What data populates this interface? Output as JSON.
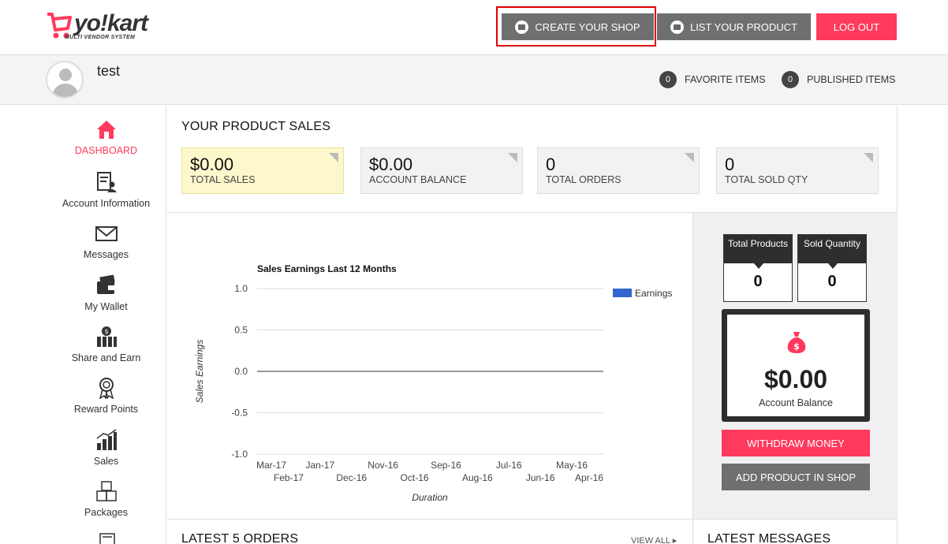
{
  "header": {
    "logo_text": "yo!kart",
    "logo_tagline": "MULTI VENDOR SYSTEM",
    "create_shop_label": "CREATE YOUR SHOP",
    "list_product_label": "LIST YOUR PRODUCT",
    "logout_label": "LOG OUT"
  },
  "profile": {
    "username": "test",
    "favorite_count": "0",
    "favorite_label": "FAVORITE ITEMS",
    "published_count": "0",
    "published_label": "PUBLISHED ITEMS"
  },
  "sidebar": {
    "items": [
      {
        "label": "DASHBOARD",
        "icon": "home-icon",
        "active": true
      },
      {
        "label": "Account Information",
        "icon": "account-info-icon"
      },
      {
        "label": "Messages",
        "icon": "envelope-icon"
      },
      {
        "label": "My Wallet",
        "icon": "wallet-icon"
      },
      {
        "label": "Share and Earn",
        "icon": "share-earn-icon"
      },
      {
        "label": "Reward Points",
        "icon": "award-icon"
      },
      {
        "label": "Sales",
        "icon": "sales-chart-icon"
      },
      {
        "label": "Packages",
        "icon": "packages-icon"
      }
    ]
  },
  "sales": {
    "title": "YOUR PRODUCT SALES",
    "cards": [
      {
        "value": "$0.00",
        "label": "TOTAL SALES"
      },
      {
        "value": "$0.00",
        "label": "ACCOUNT BALANCE"
      },
      {
        "value": "0",
        "label": "TOTAL ORDERS"
      },
      {
        "value": "0",
        "label": "TOTAL SOLD QTY"
      }
    ]
  },
  "chart_data": {
    "type": "line",
    "title": "Sales Earnings Last 12 Months",
    "xlabel": "Duration",
    "ylabel": "Sales Earnings",
    "categories": [
      "Mar-17",
      "Feb-17",
      "Jan-17",
      "Dec-16",
      "Nov-16",
      "Oct-16",
      "Sep-16",
      "Aug-16",
      "Jul-16",
      "Jun-16",
      "May-16",
      "Apr-16"
    ],
    "series": [
      {
        "name": "Earnings",
        "values": [
          0,
          0,
          0,
          0,
          0,
          0,
          0,
          0,
          0,
          0,
          0,
          0
        ],
        "color": "#3366cc"
      }
    ],
    "ylim": [
      -1.0,
      1.0
    ],
    "yticks": [
      "1.0",
      "0.5",
      "0.0",
      "-0.5",
      "-1.0"
    ],
    "legend": "right",
    "grid": true
  },
  "stats": {
    "total_products_label": "Total Products",
    "total_products_value": "0",
    "sold_quantity_label": "Sold Quantity",
    "sold_quantity_value": "0",
    "balance_value": "$0.00",
    "balance_label": "Account Balance",
    "withdraw_label": "WITHDRAW MONEY",
    "add_product_label": "ADD PRODUCT IN SHOP"
  },
  "bottom": {
    "orders_title": "LATEST 5 ORDERS",
    "view_all_label": "VIEW ALL ▸",
    "messages_title": "LATEST MESSAGES"
  },
  "colors": {
    "accent": "#ff3a5c",
    "button_gray": "#6f6f6f",
    "dark_box": "#2e2e2e",
    "series_blue": "#3366cc"
  }
}
